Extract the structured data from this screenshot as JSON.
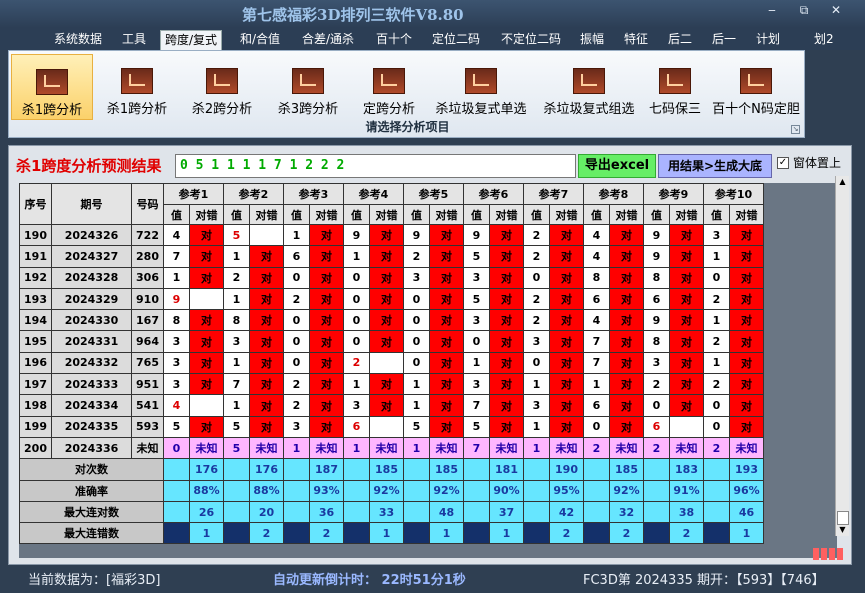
{
  "app": {
    "title": "第七感福彩3D排列三软件V8.80",
    "minimize": "‒",
    "restore": "⧉",
    "close": "✕"
  },
  "menu": [
    "系统数据",
    "工具",
    "跨度/复式",
    "和/合值",
    "合差/通杀",
    "百十个",
    "定位二码",
    "不定位二码",
    "振幅",
    "特征",
    "后二",
    "后一",
    "计划",
    "划2"
  ],
  "ribbon": {
    "buttons": [
      "杀1跨分析",
      "杀1跨分析",
      "杀2跨分析",
      "杀3跨分析",
      "定跨分析",
      "杀垃圾复式单选",
      "杀垃圾复式组选",
      "七码保三",
      "百十个N码定胆"
    ],
    "caption": "请选择分析项目"
  },
  "result": {
    "title": "杀1跨度分析预测结果",
    "value": "0 5 1 1 1 1 7 1 2 2 2",
    "export_label": "导出excel",
    "apply_label": "用结果>生成大底",
    "ontop_label": "窗体置上",
    "ontop_checked": "✓"
  },
  "table": {
    "h_seq": "序号",
    "h_period": "期号",
    "h_number": "号码",
    "refs": [
      "参考1",
      "参考2",
      "参考3",
      "参考4",
      "参考5",
      "参考6",
      "参考7",
      "参考8",
      "参考9",
      "参考10"
    ],
    "sub_val": "值",
    "sub_judge": "对错",
    "rows": [
      {
        "seq": "190",
        "period": "2024326",
        "num": "722",
        "vals": [
          "4",
          "5",
          "1",
          "9",
          "9",
          "9",
          "2",
          "4",
          "9",
          "3"
        ],
        "judge": [
          "对",
          "",
          "对",
          "对",
          "对",
          "对",
          "对",
          "对",
          "对",
          "对"
        ],
        "hl": [
          false,
          true,
          false,
          false,
          false,
          false,
          false,
          false,
          false,
          false
        ]
      },
      {
        "seq": "191",
        "period": "2024327",
        "num": "280",
        "vals": [
          "7",
          "1",
          "6",
          "1",
          "2",
          "5",
          "2",
          "4",
          "9",
          "1"
        ],
        "judge": [
          "对",
          "对",
          "对",
          "对",
          "对",
          "对",
          "对",
          "对",
          "对",
          "对"
        ],
        "hl": [
          false,
          false,
          false,
          false,
          false,
          false,
          false,
          false,
          false,
          false
        ]
      },
      {
        "seq": "192",
        "period": "2024328",
        "num": "306",
        "vals": [
          "1",
          "2",
          "0",
          "0",
          "3",
          "3",
          "0",
          "8",
          "8",
          "0"
        ],
        "judge": [
          "对",
          "对",
          "对",
          "对",
          "对",
          "对",
          "对",
          "对",
          "对",
          "对"
        ],
        "hl": [
          false,
          false,
          false,
          false,
          false,
          false,
          false,
          false,
          false,
          false
        ]
      },
      {
        "seq": "193",
        "period": "2024329",
        "num": "910",
        "vals": [
          "9",
          "1",
          "2",
          "0",
          "0",
          "5",
          "2",
          "6",
          "6",
          "2"
        ],
        "judge": [
          "",
          "对",
          "对",
          "对",
          "对",
          "对",
          "对",
          "对",
          "对",
          "对"
        ],
        "hl": [
          true,
          false,
          false,
          false,
          false,
          false,
          false,
          false,
          false,
          false
        ]
      },
      {
        "seq": "194",
        "period": "2024330",
        "num": "167",
        "vals": [
          "8",
          "8",
          "0",
          "0",
          "0",
          "3",
          "2",
          "4",
          "9",
          "1"
        ],
        "judge": [
          "对",
          "对",
          "对",
          "对",
          "对",
          "对",
          "对",
          "对",
          "对",
          "对"
        ],
        "hl": [
          false,
          false,
          false,
          false,
          false,
          false,
          false,
          false,
          false,
          false
        ]
      },
      {
        "seq": "195",
        "period": "2024331",
        "num": "964",
        "vals": [
          "3",
          "3",
          "0",
          "0",
          "0",
          "0",
          "3",
          "7",
          "8",
          "2"
        ],
        "judge": [
          "对",
          "对",
          "对",
          "对",
          "对",
          "对",
          "对",
          "对",
          "对",
          "对"
        ],
        "hl": [
          false,
          false,
          false,
          false,
          false,
          false,
          false,
          false,
          false,
          false
        ]
      },
      {
        "seq": "196",
        "period": "2024332",
        "num": "765",
        "vals": [
          "3",
          "1",
          "0",
          "2",
          "0",
          "1",
          "0",
          "7",
          "3",
          "1"
        ],
        "judge": [
          "对",
          "对",
          "对",
          "",
          "对",
          "对",
          "对",
          "对",
          "对",
          "对"
        ],
        "hl": [
          false,
          false,
          false,
          true,
          false,
          false,
          false,
          false,
          false,
          false
        ]
      },
      {
        "seq": "197",
        "period": "2024333",
        "num": "951",
        "vals": [
          "3",
          "7",
          "2",
          "1",
          "1",
          "3",
          "1",
          "1",
          "2",
          "2"
        ],
        "judge": [
          "对",
          "对",
          "对",
          "对",
          "对",
          "对",
          "对",
          "对",
          "对",
          "对"
        ],
        "hl": [
          false,
          false,
          false,
          false,
          false,
          false,
          false,
          false,
          false,
          false
        ]
      },
      {
        "seq": "198",
        "period": "2024334",
        "num": "541",
        "vals": [
          "4",
          "1",
          "2",
          "3",
          "1",
          "7",
          "3",
          "6",
          "0",
          "0"
        ],
        "judge": [
          "",
          "对",
          "对",
          "对",
          "对",
          "对",
          "对",
          "对",
          "对",
          "对"
        ],
        "hl": [
          true,
          false,
          false,
          false,
          false,
          false,
          false,
          false,
          false,
          false
        ]
      },
      {
        "seq": "199",
        "period": "2024335",
        "num": "593",
        "vals": [
          "5",
          "5",
          "3",
          "6",
          "5",
          "5",
          "1",
          "0",
          "6",
          "0"
        ],
        "judge": [
          "对",
          "对",
          "对",
          "",
          "对",
          "对",
          "对",
          "对",
          "",
          "对"
        ],
        "hl": [
          false,
          false,
          false,
          true,
          false,
          false,
          false,
          false,
          true,
          false
        ]
      },
      {
        "seq": "200",
        "period": "2024336",
        "num": "未知",
        "vals": [
          "0",
          "5",
          "1",
          "1",
          "1",
          "7",
          "1",
          "2",
          "2",
          "2"
        ],
        "judge": [
          "未知",
          "未知",
          "未知",
          "未知",
          "未知",
          "未知",
          "未知",
          "未知",
          "未知",
          "未知"
        ],
        "hl": [
          false,
          false,
          false,
          false,
          false,
          false,
          false,
          false,
          false,
          false
        ],
        "unknown": true
      }
    ],
    "stats": [
      {
        "label": "对次数",
        "values": [
          "176",
          "176",
          "187",
          "185",
          "185",
          "181",
          "190",
          "185",
          "183",
          "193"
        ]
      },
      {
        "label": "准确率",
        "values": [
          "88%",
          "88%",
          "93%",
          "92%",
          "92%",
          "90%",
          "95%",
          "92%",
          "91%",
          "96%"
        ]
      },
      {
        "label": "最大连对数",
        "values": [
          "26",
          "20",
          "36",
          "33",
          "48",
          "37",
          "42",
          "32",
          "38",
          "46"
        ]
      },
      {
        "label": "最大连错数",
        "values": [
          "1",
          "2",
          "2",
          "1",
          "1",
          "1",
          "2",
          "2",
          "2",
          "1"
        ]
      }
    ]
  },
  "status": {
    "current_data": "当前数据为：[福彩3D]",
    "countdown": "自动更新倒计时：  22时51分1秒",
    "period_info": "FC3D第 2024335 期开：【593】【746】"
  },
  "colors": {
    "accent": "#ff0000",
    "unknown_row": "#ffb6ff",
    "stats_row": "#66e6ff",
    "title": "#9fc4ea"
  }
}
